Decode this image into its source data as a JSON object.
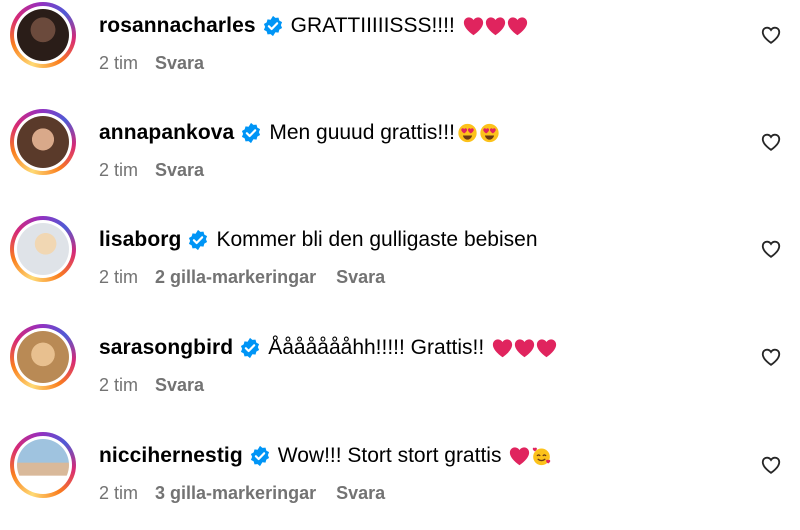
{
  "colors": {
    "verified": "#0095f6",
    "meta": "#737373",
    "heart": "#e0245e"
  },
  "comments": [
    {
      "username": "rosannacharles",
      "text": "GRATTIIIIISSS!!!!",
      "emoji": [
        "red-heart",
        "red-heart",
        "red-heart"
      ],
      "time": "2 tim",
      "likes": "",
      "reply": "Svara"
    },
    {
      "username": "annapankova",
      "text": "Men guuud grattis!!!",
      "emoji": [
        "heart-eyes-face",
        "heart-eyes-face"
      ],
      "time": "2 tim",
      "likes": "",
      "reply": "Svara"
    },
    {
      "username": "lisaborg",
      "text": "Kommer bli den gulligaste bebisen",
      "emoji": [],
      "time": "2 tim",
      "likes": "2 gilla-markeringar",
      "reply": "Svara"
    },
    {
      "username": "sarasongbird",
      "text": "Åååååååhh!!!!! Grattis!!",
      "emoji": [
        "red-heart",
        "red-heart",
        "red-heart"
      ],
      "time": "2 tim",
      "likes": "",
      "reply": "Svara"
    },
    {
      "username": "niccihernestig",
      "text": "Wow!!! Stort stort grattis",
      "emoji": [
        "red-heart",
        "smiling-face-with-hearts"
      ],
      "time": "2 tim",
      "likes": "3 gilla-markeringar",
      "reply": "Svara"
    }
  ]
}
